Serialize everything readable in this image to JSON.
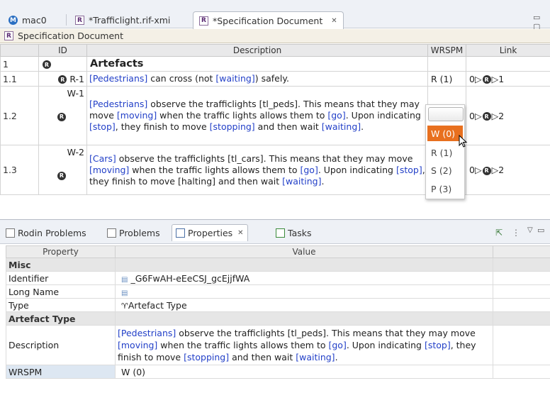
{
  "tabs": [
    {
      "label": "mac0",
      "icon": "machine-icon"
    },
    {
      "label": "*Trafficlight.rif-xmi",
      "icon": "rif-file-icon"
    },
    {
      "label": "*Specification Document",
      "icon": "rif-file-icon",
      "close": "✕"
    }
  ],
  "window_buttons": "▭ ▢",
  "editor": {
    "title": "Specification Document",
    "columns": [
      "ID",
      "Description",
      "WRSPM",
      "Link"
    ],
    "rows": [
      {
        "num": "1",
        "id": "",
        "title": "Artefacts",
        "wrspm": "",
        "link": ""
      },
      {
        "num": "1.1",
        "id": "R-1",
        "desc": [
          {
            "t": "[Pedestrians]",
            "l": true
          },
          {
            "t": " can cross (not "
          },
          {
            "t": "[waiting]",
            "l": true
          },
          {
            "t": ") safely."
          }
        ],
        "wrspm": "R (1)",
        "link": "0▷",
        "link2": "▷1"
      },
      {
        "num": "1.2",
        "id": "W-1",
        "desc": [
          {
            "t": "[Pedestrians]",
            "l": true
          },
          {
            "t": " observe the trafficlights [tl_peds]. This means that they may move "
          },
          {
            "t": "[moving]",
            "l": true
          },
          {
            "t": " when the traffic lights allows them to "
          },
          {
            "t": "[go]",
            "l": true
          },
          {
            "t": ".  Upon indicating "
          },
          {
            "t": "[stop]",
            "l": true
          },
          {
            "t": ", they finish to move "
          },
          {
            "t": "[stopping]",
            "l": true
          },
          {
            "t": " and then wait "
          },
          {
            "t": "[waiting]",
            "l": true
          },
          {
            "t": "."
          }
        ],
        "wrspm": "",
        "link": "0▷",
        "link2": "▷2"
      },
      {
        "num": "1.3",
        "id": "W-2",
        "desc": [
          {
            "t": "[Cars]",
            "l": true
          },
          {
            "t": " observe the trafficlights [tl_cars]. This means that they may move "
          },
          {
            "t": "[moving]",
            "l": true
          },
          {
            "t": " when the traffic lights allows them to "
          },
          {
            "t": "[go]",
            "l": true
          },
          {
            "t": ".  Upon indicating "
          },
          {
            "t": "[stop]",
            "l": true
          },
          {
            "t": ", they finish to move [halting] and then wait "
          },
          {
            "t": "[waiting]",
            "l": true
          },
          {
            "t": "."
          }
        ],
        "wrspm": "",
        "link": "0▷",
        "link2": "▷2"
      }
    ],
    "dropdown": {
      "options": [
        "W (0)",
        "R (1)",
        "S (2)",
        "P (3)"
      ],
      "selected": "W (0)"
    }
  },
  "bottom_tabs": [
    {
      "label": "Rodin Problems",
      "icon": "problems-icon"
    },
    {
      "label": "Problems",
      "icon": "problems-icon"
    },
    {
      "label": "Properties",
      "icon": "properties-icon",
      "close": "✕"
    },
    {
      "label": "Tasks",
      "icon": "tasks-icon"
    }
  ],
  "properties": {
    "columns": [
      "Property",
      "Value"
    ],
    "sections": [
      {
        "category": "Misc",
        "rows": [
          {
            "name": "Identifier",
            "value": "_G6FwAH-eEeCSJ_gcEjjfWA",
            "icon": "text-field-icon"
          },
          {
            "name": "Long Name",
            "value": "",
            "icon": "text-field-icon"
          },
          {
            "name": "Type",
            "value": "Artefact Type",
            "icon": "type-icon"
          }
        ]
      },
      {
        "category": "Artefact Type",
        "rows": [
          {
            "name": "Description",
            "rich": true
          },
          {
            "name": "WRSPM",
            "value": "W (0)"
          }
        ]
      }
    ]
  }
}
